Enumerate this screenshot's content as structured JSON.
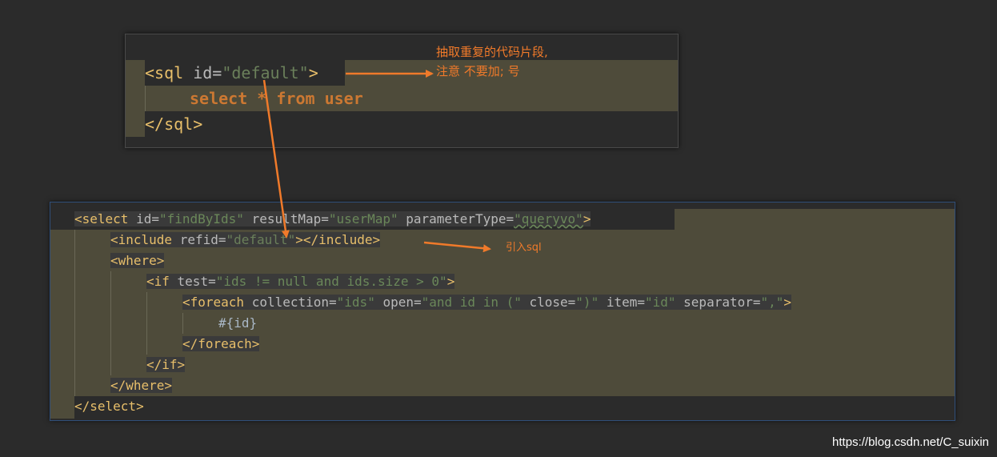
{
  "snippet1": {
    "line1": {
      "open": "<sql",
      "attr": " id=",
      "value": "\"default\"",
      "close": ">"
    },
    "line2": {
      "kw1": "select",
      "star": " * ",
      "kw2": "from",
      "kw3": " user"
    },
    "line3": "</sql>"
  },
  "snippet2": {
    "select": {
      "open": "<select",
      "a1": " id=",
      "v1": "\"findByIds\"",
      "a2": " resultMap=",
      "v2": "\"userMap\"",
      "a3": " parameterType=",
      "v3": "\"queryvo\"",
      "close": ">"
    },
    "include": {
      "open": "<include",
      "a1": " refid=",
      "v1": "\"default\"",
      "close": "></include>"
    },
    "where_open": "<where>",
    "if": {
      "open": "<if",
      "a1": " test=",
      "v1": "\"ids != null and ids.size > 0\"",
      "close": ">"
    },
    "foreach": {
      "open": "<foreach",
      "a1": " collection=",
      "v1": "\"ids\"",
      "a2": " open=",
      "v2": "\"and id in (\"",
      "a3": " close=",
      "v3": "\")\"",
      "a4": " item=",
      "v4": "\"id\"",
      "a5": " separator=",
      "v5": "\",\"",
      "close": ">"
    },
    "param": "#{id}",
    "foreach_close": "</foreach>",
    "if_close": "</if>",
    "where_close": "</where>",
    "select_close": "</select>"
  },
  "annotations": {
    "note1_line1": "抽取重复的代码片段,",
    "note1_line2": "注意 不要加; 号",
    "note2": "引入sql"
  },
  "watermark": "https://blog.csdn.net/C_suixin",
  "colors": {
    "background": "#2b2b2b",
    "highlight": "#4e4b3a",
    "tag": "#e8bf6a",
    "string": "#6a8759",
    "keyword": "#cc7832",
    "annotation": "#f07a2a"
  }
}
